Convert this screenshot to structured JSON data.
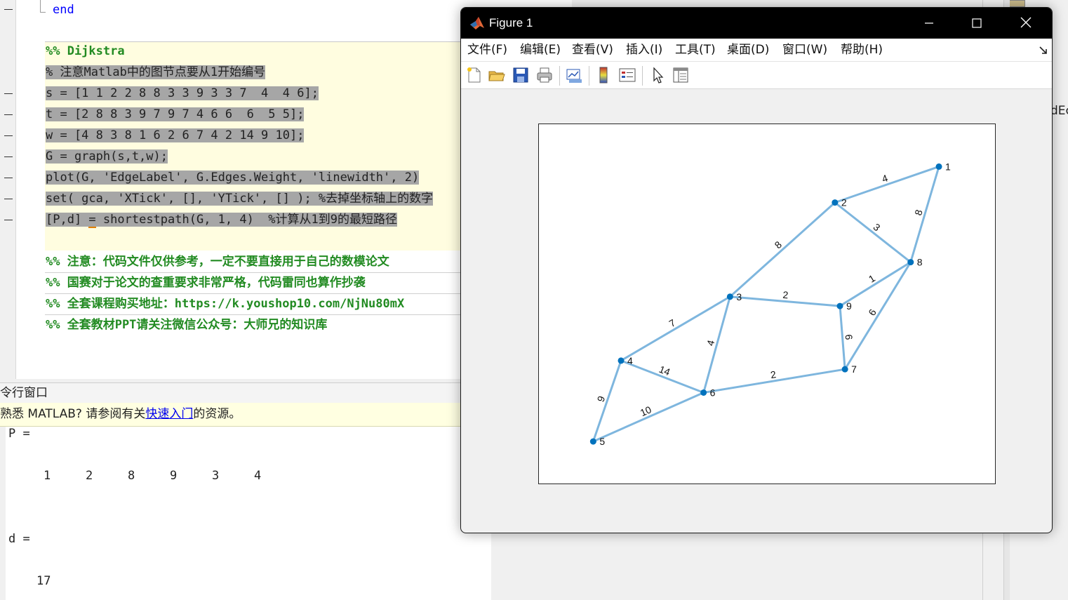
{
  "editor": {
    "fold_end_keyword": "end",
    "cell_title": "%% Dijkstra",
    "lines": [
      "% 注意Matlab中的图节点要从1开始编号",
      "s = [1 1 2 2 8 8 3 3 9 3 3 7  4  4 6];",
      "t = [2 8 8 3 9 7 9 7 4 6 6  6  5 5];",
      "w = [4 8 3 8 1 6 2 6 7 4 2 14 9 10];",
      "G = graph(s,t,w);",
      "plot(G, 'EdgeLabel', G.Edges.Weight, 'linewidth', 2)",
      "set( gca, 'XTick', [], 'YTick', [] ); %去掉坐标轴上的数字"
    ],
    "last_line_pre": "[P,d] ",
    "last_line_op": "=",
    "last_line_post": " shortestpath(G, 1, 4)  %计算从1到9的最短路径",
    "notes": [
      "%% 注意：代码文件仅供参考，一定不要直接用于自己的数模论文",
      "%% 国赛对于论文的查重要求非常严格，代码雷同也算作抄袭",
      "%% 全套课程购买地址：https://k.youshop10.com/NjNu80mX",
      "%% 全套教材PPT请关注微信公众号：大师兄的知识库"
    ]
  },
  "command_window": {
    "header": "令行窗口",
    "banner_pre": "熟悉 MATLAB? 请参阅有关",
    "banner_link": "快速入门",
    "banner_post": "的资源。",
    "p_label": "P =",
    "p_values": [
      "1",
      "2",
      "8",
      "9",
      "3",
      "4"
    ],
    "d_label": "d =",
    "d_value": "17"
  },
  "right_panel": {
    "clipped_text": "dEc"
  },
  "figure": {
    "title": "Figure 1",
    "menus": [
      "文件(F)",
      "编辑(E)",
      "查看(V)",
      "插入(I)",
      "工具(T)",
      "桌面(D)",
      "窗口(W)",
      "帮助(H)"
    ],
    "toolbar_icons": [
      "new-figure-icon",
      "open-file-icon",
      "save-icon",
      "print-icon",
      "link-plot-icon",
      "colorbar-icon",
      "legend-icon",
      "edit-plot-arrow-icon",
      "property-inspector-icon"
    ]
  },
  "chart_data": {
    "type": "graph",
    "node_color": "#0072bd",
    "edge_color": "#7eb6de",
    "nodes": [
      {
        "id": "1",
        "x": 0.877,
        "y": 0.882
      },
      {
        "id": "2",
        "x": 0.649,
        "y": 0.782
      },
      {
        "id": "3",
        "x": 0.419,
        "y": 0.52
      },
      {
        "id": "4",
        "x": 0.18,
        "y": 0.342
      },
      {
        "id": "5",
        "x": 0.119,
        "y": 0.117
      },
      {
        "id": "6",
        "x": 0.361,
        "y": 0.253
      },
      {
        "id": "7",
        "x": 0.671,
        "y": 0.318
      },
      {
        "id": "8",
        "x": 0.815,
        "y": 0.616
      },
      {
        "id": "9",
        "x": 0.66,
        "y": 0.494
      }
    ],
    "edges": [
      {
        "s": "1",
        "t": "2",
        "w": "4"
      },
      {
        "s": "1",
        "t": "8",
        "w": "8"
      },
      {
        "s": "2",
        "t": "8",
        "w": "3"
      },
      {
        "s": "2",
        "t": "3",
        "w": "8"
      },
      {
        "s": "8",
        "t": "9",
        "w": "1"
      },
      {
        "s": "8",
        "t": "7",
        "w": "6"
      },
      {
        "s": "3",
        "t": "9",
        "w": "2"
      },
      {
        "s": "3",
        "t": "7",
        "w": "6"
      },
      {
        "s": "9",
        "t": "4",
        "w": "7"
      },
      {
        "s": "3",
        "t": "6",
        "w": "4"
      },
      {
        "s": "3",
        "t": "6",
        "w": "2"
      },
      {
        "s": "7",
        "t": "6",
        "w": "14"
      },
      {
        "s": "4",
        "t": "5",
        "w": "9"
      },
      {
        "s": "4",
        "t": "5",
        "w": "10"
      }
    ],
    "displayed_edges": [
      {
        "s": "1",
        "t": "2",
        "w": "4"
      },
      {
        "s": "1",
        "t": "8",
        "w": "8"
      },
      {
        "s": "2",
        "t": "8",
        "w": "3"
      },
      {
        "s": "2",
        "t": "3",
        "w": "8"
      },
      {
        "s": "8",
        "t": "9",
        "w": "1"
      },
      {
        "s": "8",
        "t": "7",
        "w": "6"
      },
      {
        "s": "3",
        "t": "9",
        "w": "2"
      },
      {
        "s": "9",
        "t": "7",
        "w": "6"
      },
      {
        "s": "3",
        "t": "4",
        "w": "7"
      },
      {
        "s": "3",
        "t": "6",
        "w": "4"
      },
      {
        "s": "6",
        "t": "7",
        "w": "2"
      },
      {
        "s": "4",
        "t": "6",
        "w": "14"
      },
      {
        "s": "4",
        "t": "5",
        "w": "9"
      },
      {
        "s": "5",
        "t": "6",
        "w": "10"
      }
    ],
    "xticks": [],
    "yticks": []
  }
}
